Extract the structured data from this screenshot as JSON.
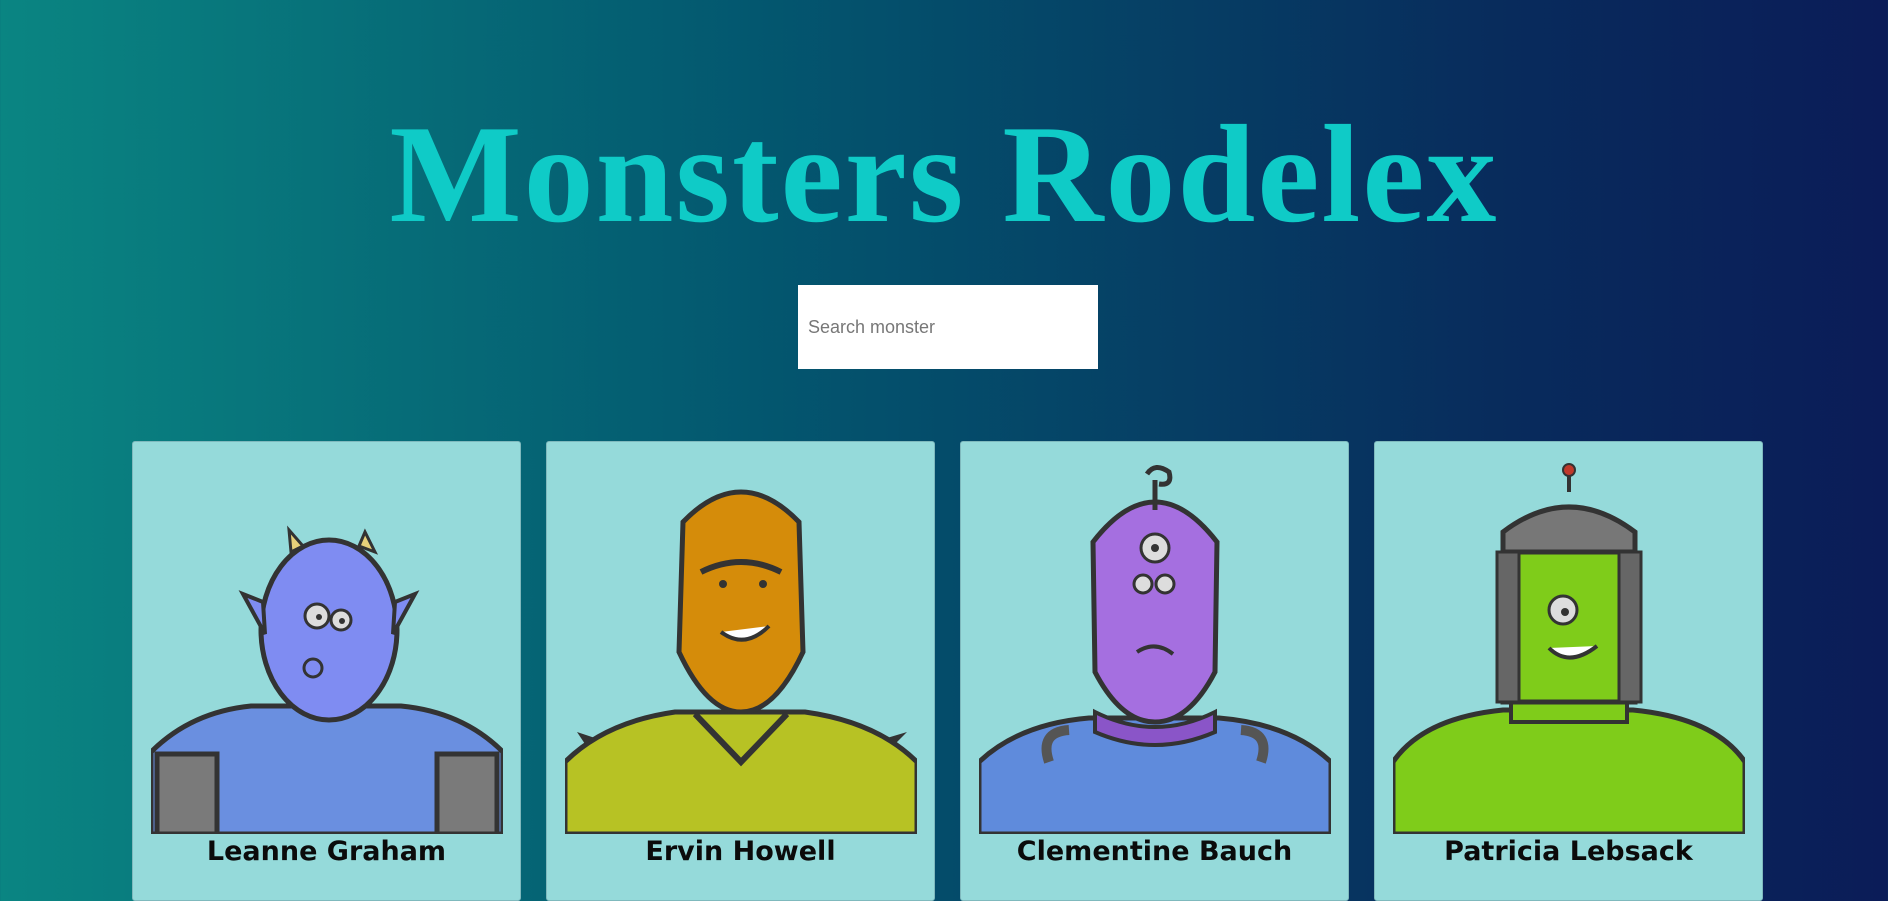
{
  "header": {
    "title": "Monsters Rodelex"
  },
  "search": {
    "placeholder": "Search monster",
    "value": ""
  },
  "monsters": [
    {
      "name": "Leanne Graham"
    },
    {
      "name": "Ervin Howell"
    },
    {
      "name": "Clementine Bauch"
    },
    {
      "name": "Patricia Lebsack"
    }
  ],
  "colors": {
    "title": "#0fcbc7",
    "card_background": "#95dada",
    "background_start": "#0a8582",
    "background_end": "#0b1c58"
  }
}
